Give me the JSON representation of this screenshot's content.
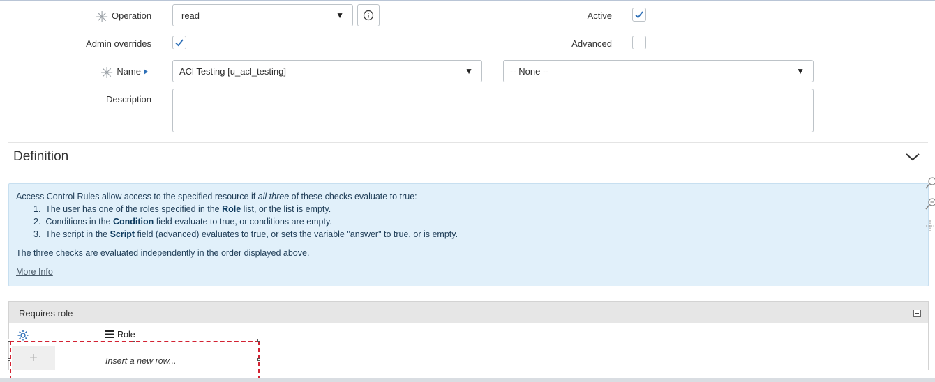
{
  "form": {
    "operation": {
      "label": "Operation",
      "value": "read"
    },
    "active": {
      "label": "Active",
      "checked": true
    },
    "admin_overrides": {
      "label": "Admin overrides",
      "checked": true
    },
    "advanced": {
      "label": "Advanced",
      "checked": false
    },
    "name": {
      "label": "Name",
      "table_value": "ACl Testing [u_acl_testing]",
      "field_value": "-- None --"
    },
    "description": {
      "label": "Description",
      "value": ""
    }
  },
  "definition": {
    "title": "Definition",
    "intro_before": "Access Control Rules allow access to the specified resource if ",
    "intro_em": "all three",
    "intro_after": " of these checks evaluate to true:",
    "items": [
      {
        "num": "1.",
        "before": "The user has one of the roles specified in the ",
        "bold": "Role",
        "after": " list, or the list is empty."
      },
      {
        "num": "2.",
        "before": "Conditions in the ",
        "bold": "Condition",
        "after": " field evaluate to true, or conditions are empty."
      },
      {
        "num": "3.",
        "before": "The script in the ",
        "bold": "Script",
        "after": " field (advanced) evaluates to true, or sets the variable \"answer\" to true, or is empty."
      }
    ],
    "footer": "The three checks are evaluated independently in the order displayed above.",
    "more_info": "More Info"
  },
  "requires_role": {
    "title": "Requires role",
    "column": "Role",
    "insert_placeholder": "Insert a new row...",
    "add_symbol": "+"
  },
  "colors": {
    "accent": "#2d6fb7",
    "selection": "#d32232",
    "info_bg": "#e1f0fa"
  },
  "icons": [
    "required-asterisk-icon",
    "info-icon",
    "reference-arrow-icon",
    "chevron-down-icon",
    "zoom-in-icon",
    "zoom-out-icon",
    "move-icon",
    "gear-icon",
    "list-menu-icon",
    "collapse-list-icon"
  ]
}
